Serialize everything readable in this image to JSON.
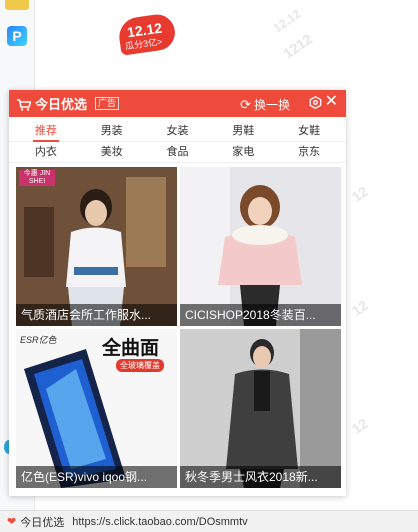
{
  "background": {
    "promo_badge": {
      "number": "12.12",
      "subtitle": "瓜分3亿>"
    },
    "watermarks": [
      "12.12",
      "1212",
      "12"
    ]
  },
  "popup": {
    "title": "今日优选",
    "ad_tag": "广告",
    "refresh_label": "换一换",
    "accent_color": "#ee4b3d",
    "tabs_row1": [
      "推荐",
      "男装",
      "女装",
      "男鞋",
      "女鞋"
    ],
    "tabs_row2": [
      "内衣",
      "美妆",
      "食品",
      "家电",
      "京东"
    ],
    "active_tab": "推荐",
    "cards": [
      {
        "caption": "气质酒店会所工作服水...",
        "image_text": "今惠 JIN SHEI"
      },
      {
        "caption": "CICISHOP2018冬装百...",
        "image_text": ""
      },
      {
        "caption": "亿色(ESR)vivo iqoo钢...",
        "image_text": "ESR亿色",
        "headline": "全曲面",
        "sub": "全玻璃覆盖"
      },
      {
        "caption": "秋冬季男士风衣2018新...",
        "image_text": ""
      }
    ]
  },
  "statusbar": {
    "label": "今日优选",
    "url": "https://s.click.taobao.com/DOsmmtv"
  }
}
